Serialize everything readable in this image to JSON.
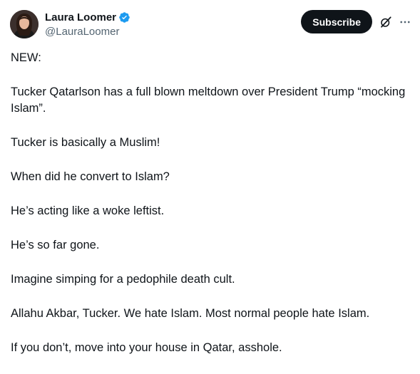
{
  "author": {
    "display_name": "Laura Loomer",
    "handle": "@LauraLoomer",
    "verified_icon": "verified-badge-icon",
    "verified_color": "#1d9bf0"
  },
  "actions": {
    "subscribe_label": "Subscribe",
    "grok_icon": "grok-icon",
    "more_icon": "more-options-icon"
  },
  "post": {
    "paragraphs": [
      "NEW:",
      "Tucker Qatarlson has a full blown meltdown over President Trump “mocking Islam”.",
      "Tucker is basically a Muslim!",
      "When did he convert to Islam?",
      "He’s acting like a woke leftist.",
      "He’s so far gone.",
      "Imagine simping for a pedophile death cult.",
      "Allahu Akbar, Tucker. We hate Islam. Most normal people hate Islam.",
      "If you don’t, move into your house in Qatar, asshole."
    ]
  }
}
